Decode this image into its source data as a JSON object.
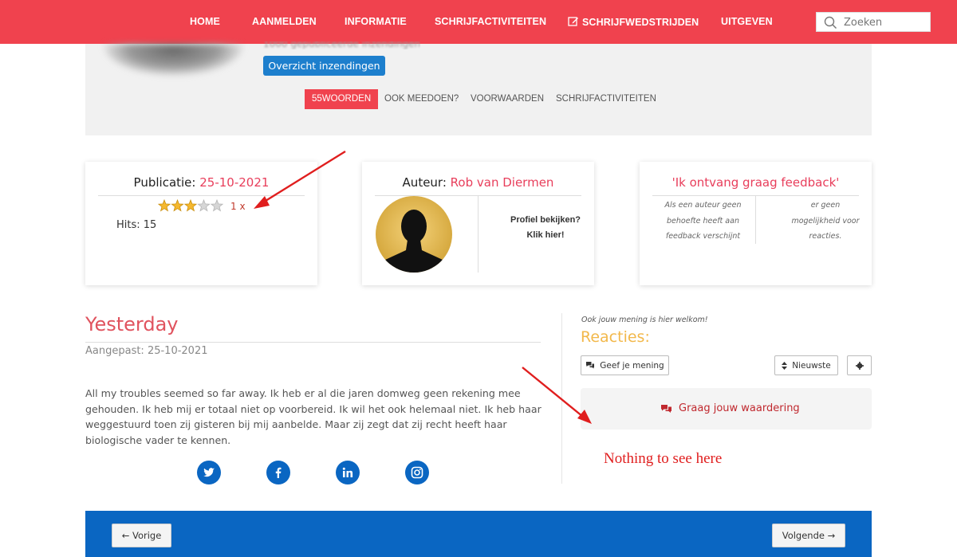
{
  "nav": {
    "home": "HOME",
    "aanmelden": "AANMELDEN",
    "informatie": "INFORMATIE",
    "schrijfactiviteiten": "SCHRIJFACTIVITEITEN",
    "schrijfwedstrijden": "SCHRIJFWEDSTRIJDEN",
    "uitgeven": "UITGEVEN",
    "search_placeholder": "Zoeken"
  },
  "header": {
    "published_count": "1000 gepubliceerde inzendingen",
    "overview_button": "Overzicht inzendingen",
    "subtabs": [
      "55WOORDEN",
      "OOK MEEDOEN?",
      "VOORWAARDEN",
      "SCHRIJFACTIVITEITEN"
    ]
  },
  "publication_card": {
    "label": "Publicatie:",
    "date": "25-10-2021",
    "rating": 3,
    "rating_max": 5,
    "rating_count": "1 x",
    "hits_label": "Hits:",
    "hits": "15"
  },
  "author_card": {
    "label": "Auteur:",
    "name": "Rob van Diermen",
    "profile_line1": "Profiel bekijken?",
    "profile_line2": "Klik hier!"
  },
  "feedback_card": {
    "title": "'Ik ontvang graag feedback'",
    "col1": [
      "Als een auteur geen",
      "behoefte heeft aan",
      "feedback verschijnt"
    ],
    "col2": [
      "er geen",
      "mogelijkheid voor",
      "reacties."
    ]
  },
  "article": {
    "title": "Yesterday",
    "modified": "Aangepast: 25-10-2021",
    "body": "All my troubles seemed so far away. Ik heb er al die jaren domweg geen rekening mee gehouden. Ik heb mij er totaal niet op voorbereid. Ik wil het ook helemaal niet. Ik heb haar weggestuurd toen zij gisteren bij mij aanbelde. Maar zij zegt dat zij recht heeft haar biologische vader te kennen."
  },
  "comments": {
    "welcome": "Ook jouw mening is hier welkom!",
    "title": "Reacties:",
    "give_opinion": "Geef je mening",
    "sort": "Nieuwste",
    "appreciation": "Graag jouw waardering",
    "annotation": "Nothing to see here"
  },
  "footer": {
    "prev": "← Vorige",
    "next": "Volgende →"
  },
  "colors": {
    "brand_red": "#f0424e",
    "accent_pink": "#e83e5b",
    "brand_blue": "#0a66c2",
    "reacties_yellow": "#f2b84b",
    "annotation_red": "#e01e1e"
  }
}
